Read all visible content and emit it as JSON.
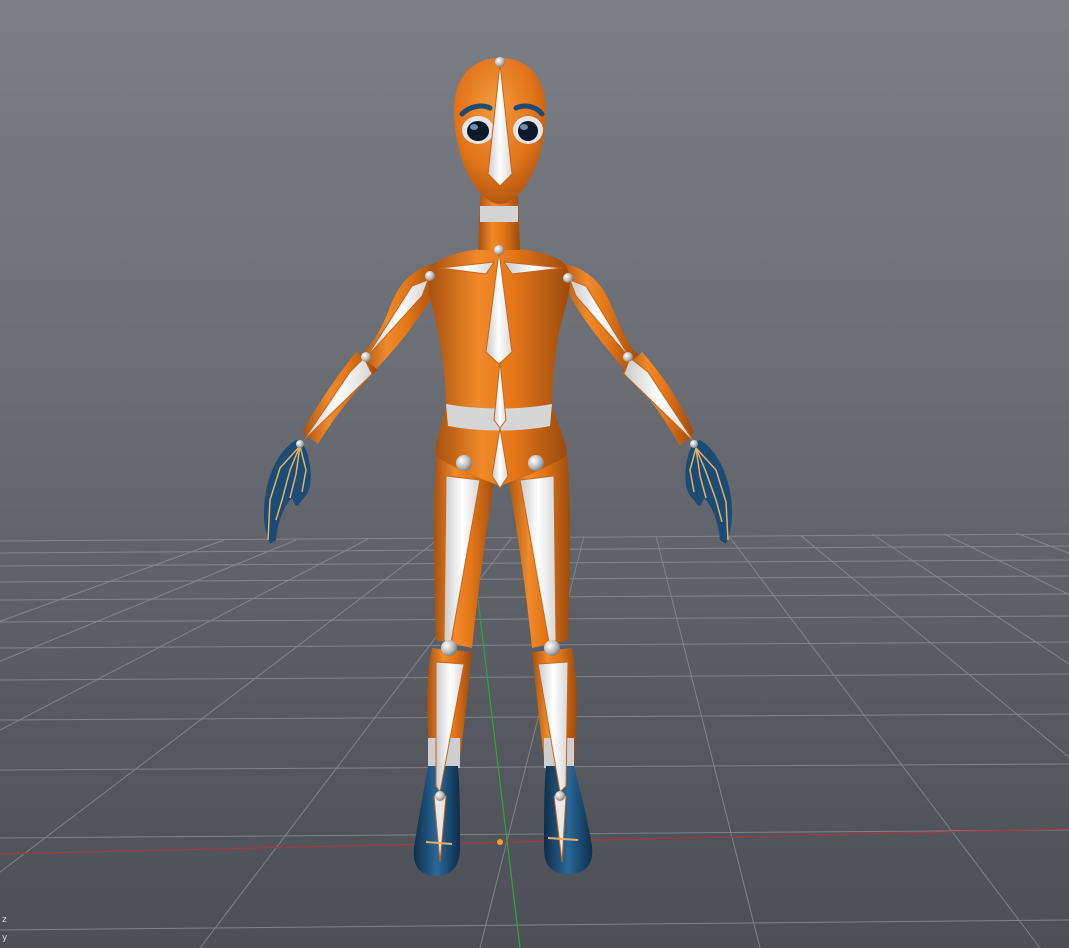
{
  "viewport": {
    "background_top": "#7c7f86",
    "background_bottom": "#4c4f55",
    "grid_color": "#8e9197",
    "x_axis_color": "#a23a3a",
    "y_axis_color": "#3aa13a"
  },
  "character": {
    "skin_color": "#e2741a",
    "accent_color": "#1c4b73",
    "bone_color": "#f4f4f4",
    "joint_color": "#b9b9b9",
    "outline_color": "#c8651a"
  },
  "axis_gizmo": {
    "z_label": "z",
    "y_label": "y"
  }
}
